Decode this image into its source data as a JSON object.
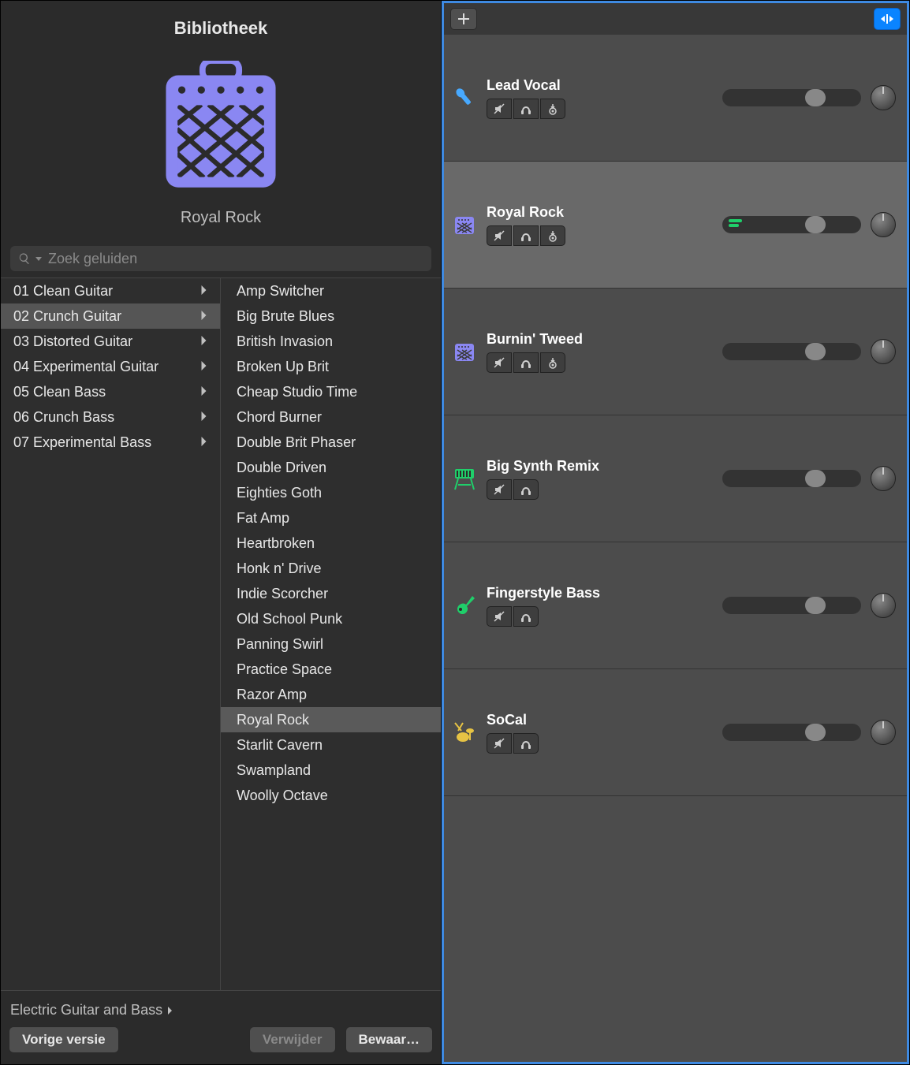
{
  "library": {
    "title": "Bibliotheek",
    "preset_name": "Royal Rock",
    "search_placeholder": "Zoek geluiden",
    "categories": [
      {
        "label": "01 Clean Guitar",
        "selected": false
      },
      {
        "label": "02 Crunch Guitar",
        "selected": true
      },
      {
        "label": "03 Distorted Guitar",
        "selected": false
      },
      {
        "label": "04 Experimental Guitar",
        "selected": false
      },
      {
        "label": "05 Clean Bass",
        "selected": false
      },
      {
        "label": "06 Crunch Bass",
        "selected": false
      },
      {
        "label": "07 Experimental Bass",
        "selected": false
      }
    ],
    "presets": [
      {
        "label": "Amp Switcher",
        "selected": false
      },
      {
        "label": "Big Brute Blues",
        "selected": false
      },
      {
        "label": "British Invasion",
        "selected": false
      },
      {
        "label": "Broken Up Brit",
        "selected": false
      },
      {
        "label": "Cheap Studio Time",
        "selected": false
      },
      {
        "label": "Chord Burner",
        "selected": false
      },
      {
        "label": "Double Brit Phaser",
        "selected": false
      },
      {
        "label": "Double Driven",
        "selected": false
      },
      {
        "label": "Eighties Goth",
        "selected": false
      },
      {
        "label": "Fat Amp",
        "selected": false
      },
      {
        "label": "Heartbroken",
        "selected": false
      },
      {
        "label": "Honk n' Drive",
        "selected": false
      },
      {
        "label": "Indie Scorcher",
        "selected": false
      },
      {
        "label": "Old School Punk",
        "selected": false
      },
      {
        "label": "Panning Swirl",
        "selected": false
      },
      {
        "label": "Practice Space",
        "selected": false
      },
      {
        "label": "Razor Amp",
        "selected": false
      },
      {
        "label": "Royal Rock",
        "selected": true
      },
      {
        "label": "Starlit Cavern",
        "selected": false
      },
      {
        "label": "Swampland",
        "selected": false
      },
      {
        "label": "Woolly Octave",
        "selected": false
      }
    ],
    "breadcrumb": "Electric Guitar and Bass",
    "buttons": {
      "previous": "Vorige versie",
      "delete": "Verwijder",
      "save": "Bewaar…"
    },
    "accent_color": "#8a87f2"
  },
  "tracks_panel": {
    "selection_color": "#3e8ae2",
    "tracks": [
      {
        "name": "Lead Vocal",
        "icon": "mic",
        "color": "#47a9ff",
        "selected": false,
        "has_input": true,
        "volume": 0.7,
        "pan": 0,
        "meter": 0
      },
      {
        "name": "Royal Rock",
        "icon": "amp",
        "color": "#8a87f2",
        "selected": true,
        "has_input": true,
        "volume": 0.7,
        "pan": 0,
        "meter": 0.12
      },
      {
        "name": "Burnin' Tweed",
        "icon": "amp",
        "color": "#8a87f2",
        "selected": false,
        "has_input": true,
        "volume": 0.7,
        "pan": 0,
        "meter": 0
      },
      {
        "name": "Big Synth Remix",
        "icon": "synth",
        "color": "#1fcf6a",
        "selected": false,
        "has_input": false,
        "volume": 0.7,
        "pan": 0,
        "meter": 0
      },
      {
        "name": "Fingerstyle Bass",
        "icon": "guitar",
        "color": "#1fcf6a",
        "selected": false,
        "has_input": false,
        "volume": 0.7,
        "pan": 0,
        "meter": 0
      },
      {
        "name": "SoCal",
        "icon": "drums",
        "color": "#e6c344",
        "selected": false,
        "has_input": false,
        "volume": 0.7,
        "pan": 0,
        "meter": 0
      }
    ]
  }
}
